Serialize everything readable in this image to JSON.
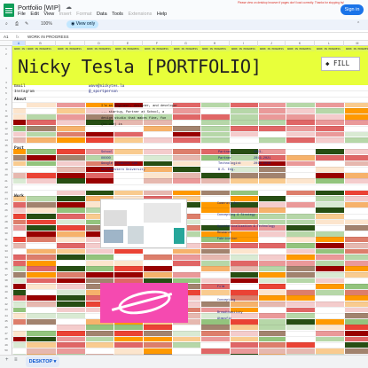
{
  "app": {
    "title": "Portfolio [WIP]",
    "menus": [
      "File",
      "Edit",
      "View",
      "Insert",
      "Format",
      "Data",
      "Tools",
      "Extensions",
      "Help"
    ],
    "disabled_menus": [
      "Insert",
      "Format",
      "Extensions"
    ],
    "sign_in": "Sign in",
    "note": "Please view on desktop browser if pages don't load correctly. Thanks for stopping by!"
  },
  "toolbar": {
    "zoom": "100%",
    "view_only": "View only"
  },
  "formula": {
    "cell_ref": "A1",
    "fx": "fx",
    "value": "WORK IN PROGRESS"
  },
  "columns": [
    "A",
    "B",
    "C",
    "D",
    "E",
    "F",
    "G",
    "H",
    "I",
    "J",
    "K",
    "L",
    "M"
  ],
  "banner": "WORK IN PROGRESS",
  "header": {
    "name": "Nicky Tesla [PORTFOLIO]",
    "fill_label": "FILL",
    "email_label": "Email",
    "email": "wave@nickytes.la",
    "insta_label": "Instagram",
    "insta": "@_sportperson"
  },
  "about": {
    "label": "About",
    "lines": [
      "I'm an engineer, designer, and developer",
      "... startup, Partner at School, a",
      "design studio that makes fine, fun",
      "(to use) is"
    ]
  },
  "past": {
    "label": "Past",
    "left": [
      "School",
      "OOOOO",
      "Google Creative Lab",
      "Northwestern University"
    ],
    "roles": [
      "Partner",
      "Partner",
      "Technologist",
      "B.S. Eng."
    ],
    "years": [
      "2021-",
      "2016-2021",
      "2013-2016",
      ""
    ]
  },
  "work": {
    "label": "Work",
    "items": [
      "Camerasy Arc",
      "Concepting & Strategy",
      "Hypotheticalization & Technology",
      "Research",
      "Fabrication",
      "Film",
      "Concepting",
      "Breadthability",
      "Atmosfit"
    ]
  },
  "bottom": {
    "sheet_tab": "DESKTOP",
    "add": "+",
    "menu": "≡"
  }
}
